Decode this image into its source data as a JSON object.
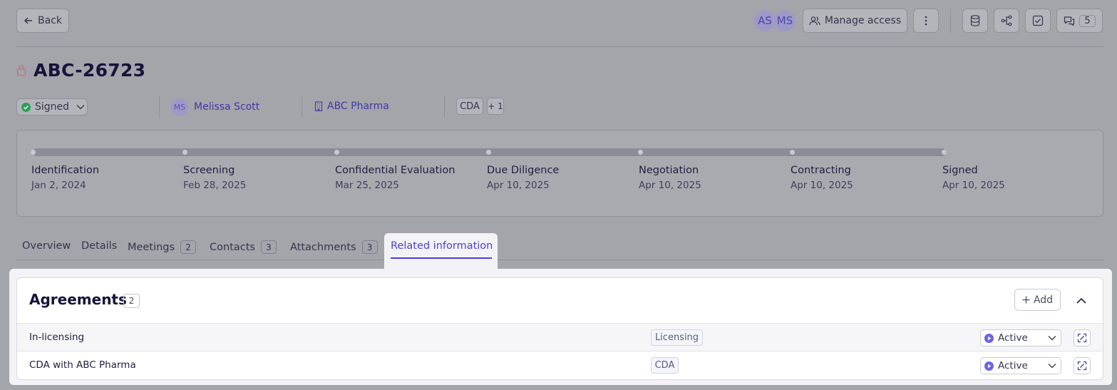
{
  "header": {
    "back_label": "Back",
    "avatars": [
      "AS",
      "MS"
    ],
    "manage_access_label": "Manage access",
    "comments_count": "5"
  },
  "record": {
    "title": "ABC-26723",
    "status": "Signed",
    "status_color": "#2ea05a",
    "owner_initials": "MS",
    "owner_name": "Melissa Scott",
    "company": "ABC Pharma",
    "type_tag": "CDA",
    "extra_tags": "+ 1"
  },
  "timeline": {
    "stages": [
      {
        "name": "Identification",
        "date": "Jan 2, 2024"
      },
      {
        "name": "Screening",
        "date": "Feb 28, 2025"
      },
      {
        "name": "Confidential Evaluation",
        "date": "Mar 25, 2025"
      },
      {
        "name": "Due Diligence",
        "date": "Apr 10, 2025"
      },
      {
        "name": "Negotiation",
        "date": "Apr 10, 2025"
      },
      {
        "name": "Contracting",
        "date": "Apr 10, 2025"
      },
      {
        "name": "Signed",
        "date": "Apr 10, 2025"
      }
    ]
  },
  "tabs": [
    {
      "label": "Overview"
    },
    {
      "label": "Details"
    },
    {
      "label": "Meetings",
      "count": "2"
    },
    {
      "label": "Contacts",
      "count": "3"
    },
    {
      "label": "Attachments",
      "count": "3"
    },
    {
      "label": "Related information",
      "active": true
    }
  ],
  "agreements": {
    "title": "Agreements",
    "count": "2",
    "add_label": "Add",
    "rows": [
      {
        "name": "In-licensing",
        "type": "Licensing",
        "status": "Active"
      },
      {
        "name": "CDA with ABC Pharma",
        "type": "CDA",
        "status": "Active"
      }
    ]
  },
  "colors": {
    "accent": "#4a3fd8",
    "active_status": "#6e63e6"
  }
}
